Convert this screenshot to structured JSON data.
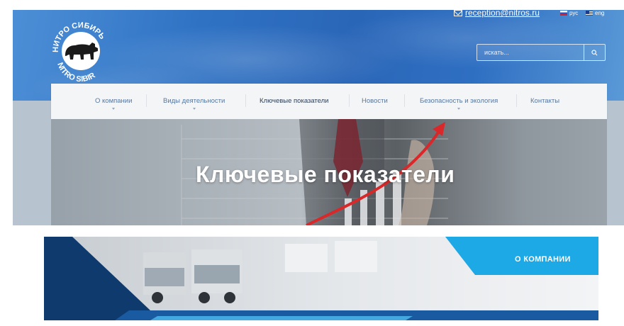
{
  "header": {
    "logo_text_top": "НИТРО СИБИРЬ",
    "logo_text_bottom": "NITRO SIBIR",
    "email": "reception@nitros.ru",
    "lang_ru": "рус",
    "lang_en": "eng"
  },
  "search": {
    "placeholder": "искать..."
  },
  "nav": {
    "items": [
      {
        "label": "О компании",
        "has_dropdown": true
      },
      {
        "label": "Виды деятельности",
        "has_dropdown": true
      },
      {
        "label": "Ключевые показатели",
        "has_dropdown": false
      },
      {
        "label": "Новости",
        "has_dropdown": false
      },
      {
        "label": "Безопасность и экология",
        "has_dropdown": true
      },
      {
        "label": "Контакты",
        "has_dropdown": false
      }
    ]
  },
  "hero": {
    "title": "Ключевые показатели"
  },
  "banner": {
    "button_label": "О КОМПАНИИ"
  },
  "colors": {
    "header_blue": "#2f6fc2",
    "nav_text": "#5577a0",
    "banner_accent": "#1da8e6",
    "banner_dark": "#0f3a6e",
    "arrow_red": "#d8282a"
  },
  "icons": [
    "mail-icon",
    "search-icon",
    "flag-ru-icon",
    "flag-en-icon",
    "bear-icon",
    "chevron-down-icon"
  ]
}
